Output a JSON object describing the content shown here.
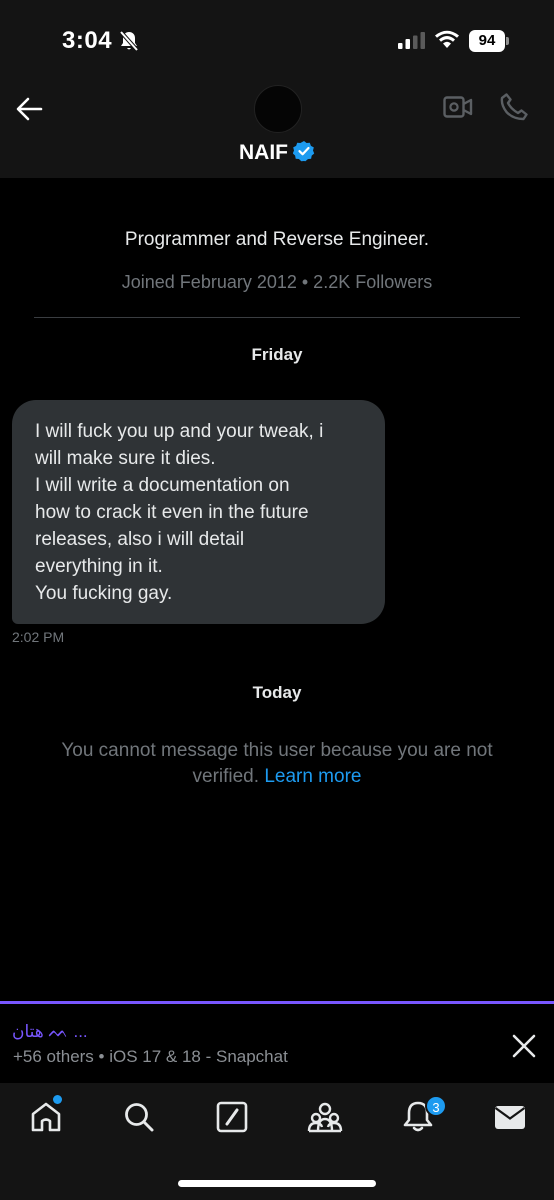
{
  "status_bar": {
    "time": "3:04",
    "battery": "94"
  },
  "header": {
    "name": "NAIF"
  },
  "profile": {
    "bio": "Programmer and Reverse Engineer.",
    "joined": "Joined February 2012 • 2.2K Followers"
  },
  "conversation": {
    "day_1": "Friday",
    "message": {
      "lines": [
        "I will fuck you up and your tweak, i",
        "will make sure it dies.",
        "I will write a documentation on",
        "how to crack it even in the future",
        "releases, also i will detail",
        "everything in it.",
        "You fucking gay."
      ],
      "time": "2:02 PM"
    },
    "day_2": "Today",
    "notice": "You cannot message this user because you are not verified.",
    "learn_more": "Learn more"
  },
  "now_playing": {
    "title": "هتان ᨓ ...",
    "subtitle": "+56 others • iOS 17 &  18 - Snapchat"
  },
  "tab_bar": {
    "notifications_count": "3"
  },
  "colors": {
    "accent": "#1d9bf0",
    "spaces_purple": "#7856ff",
    "background": "#000000",
    "bubble": "#2f3336"
  }
}
